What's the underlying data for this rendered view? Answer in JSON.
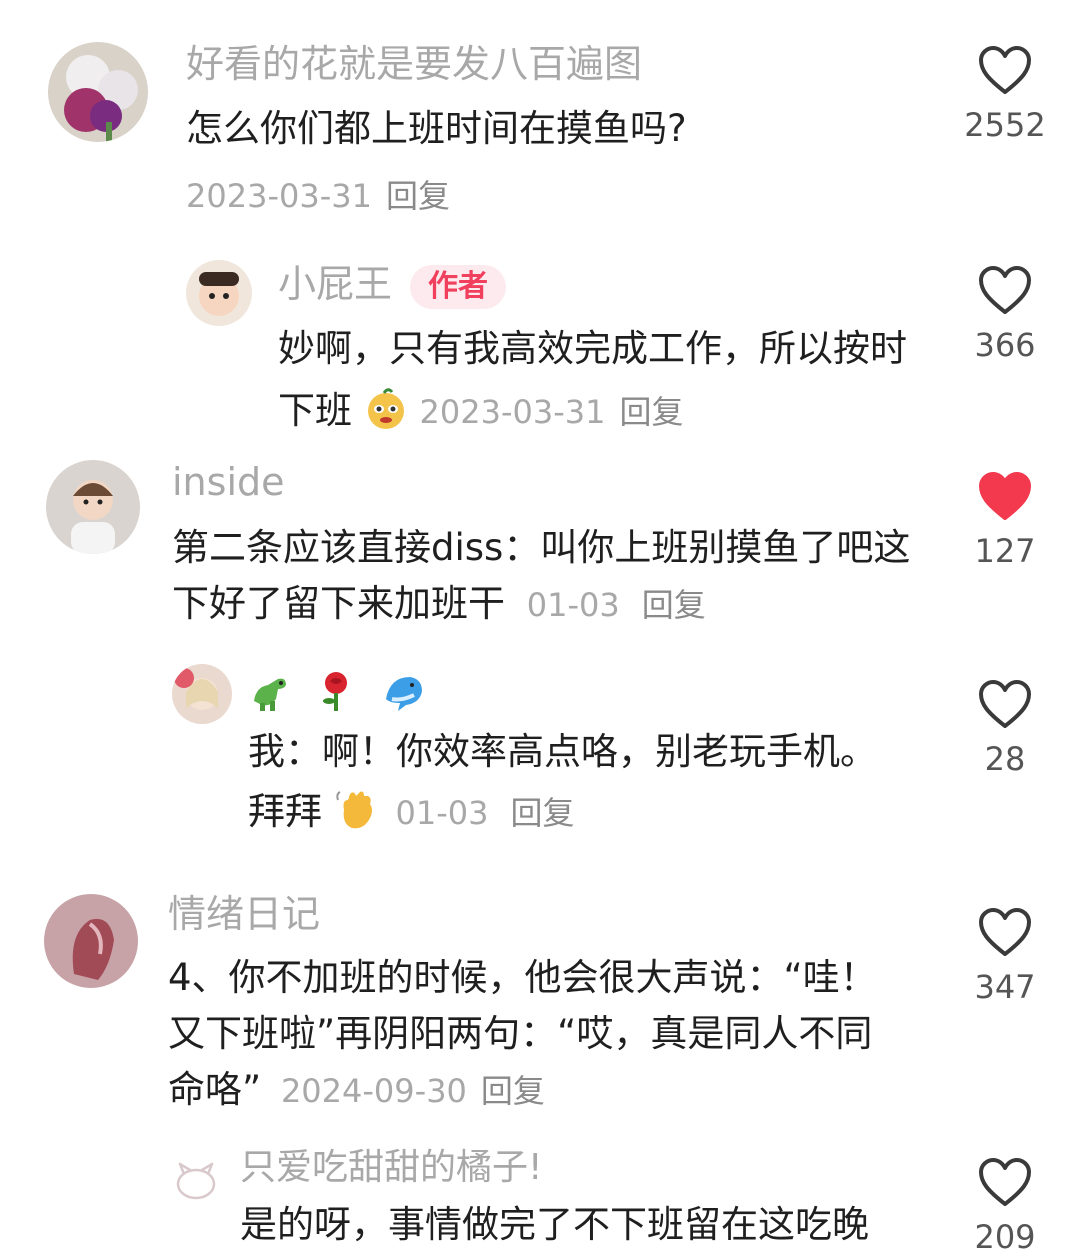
{
  "colors": {
    "like_active": "#f2394e",
    "name": "#a8a8a8",
    "text": "#1f1f1f",
    "badge_bg": "#fdeaee",
    "badge_text": "#f0405e"
  },
  "comments": [
    {
      "name": "好看的花就是要发八百遍图",
      "text": "怎么你们都上班时间在摸鱼吗?",
      "date": "2023-03-31",
      "reply": "回复",
      "likes": "2552",
      "liked": false
    },
    {
      "name": "小屁王",
      "badge": "作者",
      "text": "妙啊，只有我高效完成工作，所以按时下班",
      "date": "2023-03-31",
      "reply": "回复",
      "likes": "366",
      "liked": false
    },
    {
      "name": "inside",
      "text": "第二条应该直接diss：叫你上班别摸鱼了吧这下好了留下来加班干",
      "date": "01-03",
      "reply": "回复",
      "likes": "127",
      "liked": true
    },
    {
      "name_emojis": [
        "dinosaur-icon",
        "rose-icon",
        "dolphin-icon"
      ],
      "text": "我：啊！你效率高点咯，别老玩手机。拜拜",
      "date": "01-03",
      "reply": "回复",
      "likes": "28",
      "liked": false
    },
    {
      "name": "情绪日记",
      "text": "4、你不加班的时候，他会很大声说：“哇！又下班啦”再阴阳两句：“哎，真是同人不同命咯”",
      "date": "2024-09-30",
      "reply": "回复",
      "likes": "347",
      "liked": false
    },
    {
      "name": "只爱吃甜甜的橘子!",
      "text": "是的呀，事情做完了不下班留在这吃晚",
      "likes": "209",
      "liked": false
    }
  ]
}
